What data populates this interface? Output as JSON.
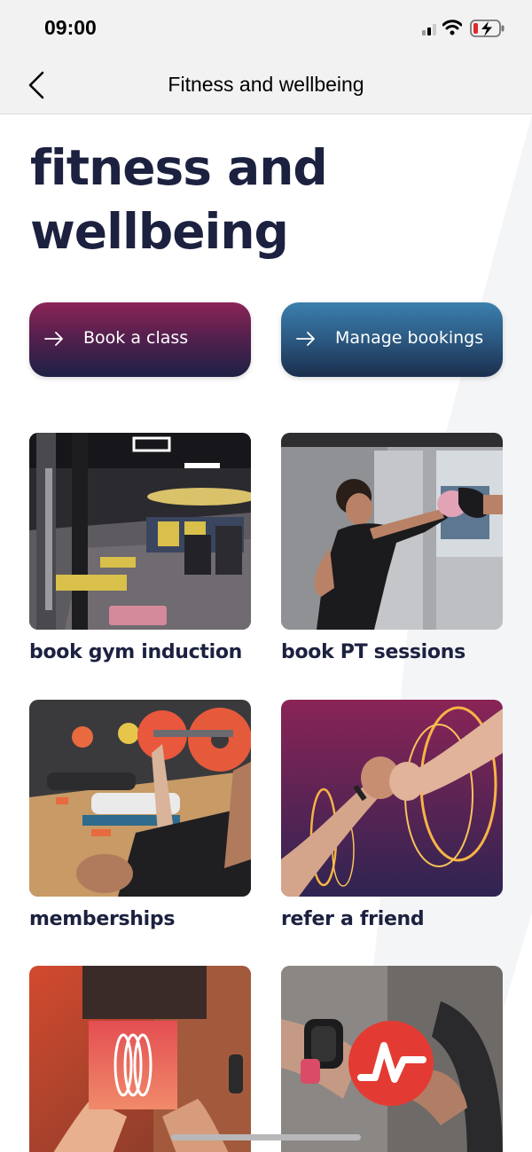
{
  "status_bar": {
    "time": "09:00",
    "icons": [
      "signal-icon",
      "wifi-icon",
      "battery-charging-icon"
    ]
  },
  "nav": {
    "back_icon": "chevron-left-icon",
    "title": "Fitness and wellbeing"
  },
  "page": {
    "title_line1": "fitness and",
    "title_line2": "wellbeing"
  },
  "actions": {
    "book_class_label": "Book a class",
    "manage_bookings_label": "Manage bookings",
    "arrow_icon": "arrow-right-icon"
  },
  "tiles": [
    {
      "label": "book gym induction",
      "image": "gym-floor-photo"
    },
    {
      "label": "book PT sessions",
      "image": "boxing-pads-photo"
    },
    {
      "label": "memberships",
      "image": "weights-class-photo"
    },
    {
      "label": "refer a friend",
      "image": "fist-bump-photo"
    },
    {
      "label": "",
      "image": "wellbeing-app-photo"
    },
    {
      "label": "",
      "image": "fitness-tracker-photo"
    }
  ],
  "colors": {
    "title_text": "#1c2140",
    "book_class_gradient": [
      "#8c2457",
      "#1d2145"
    ],
    "manage_bookings_gradient": [
      "#3c7fae",
      "#1b2f4e"
    ],
    "bar_background": "#f2f2f3"
  }
}
